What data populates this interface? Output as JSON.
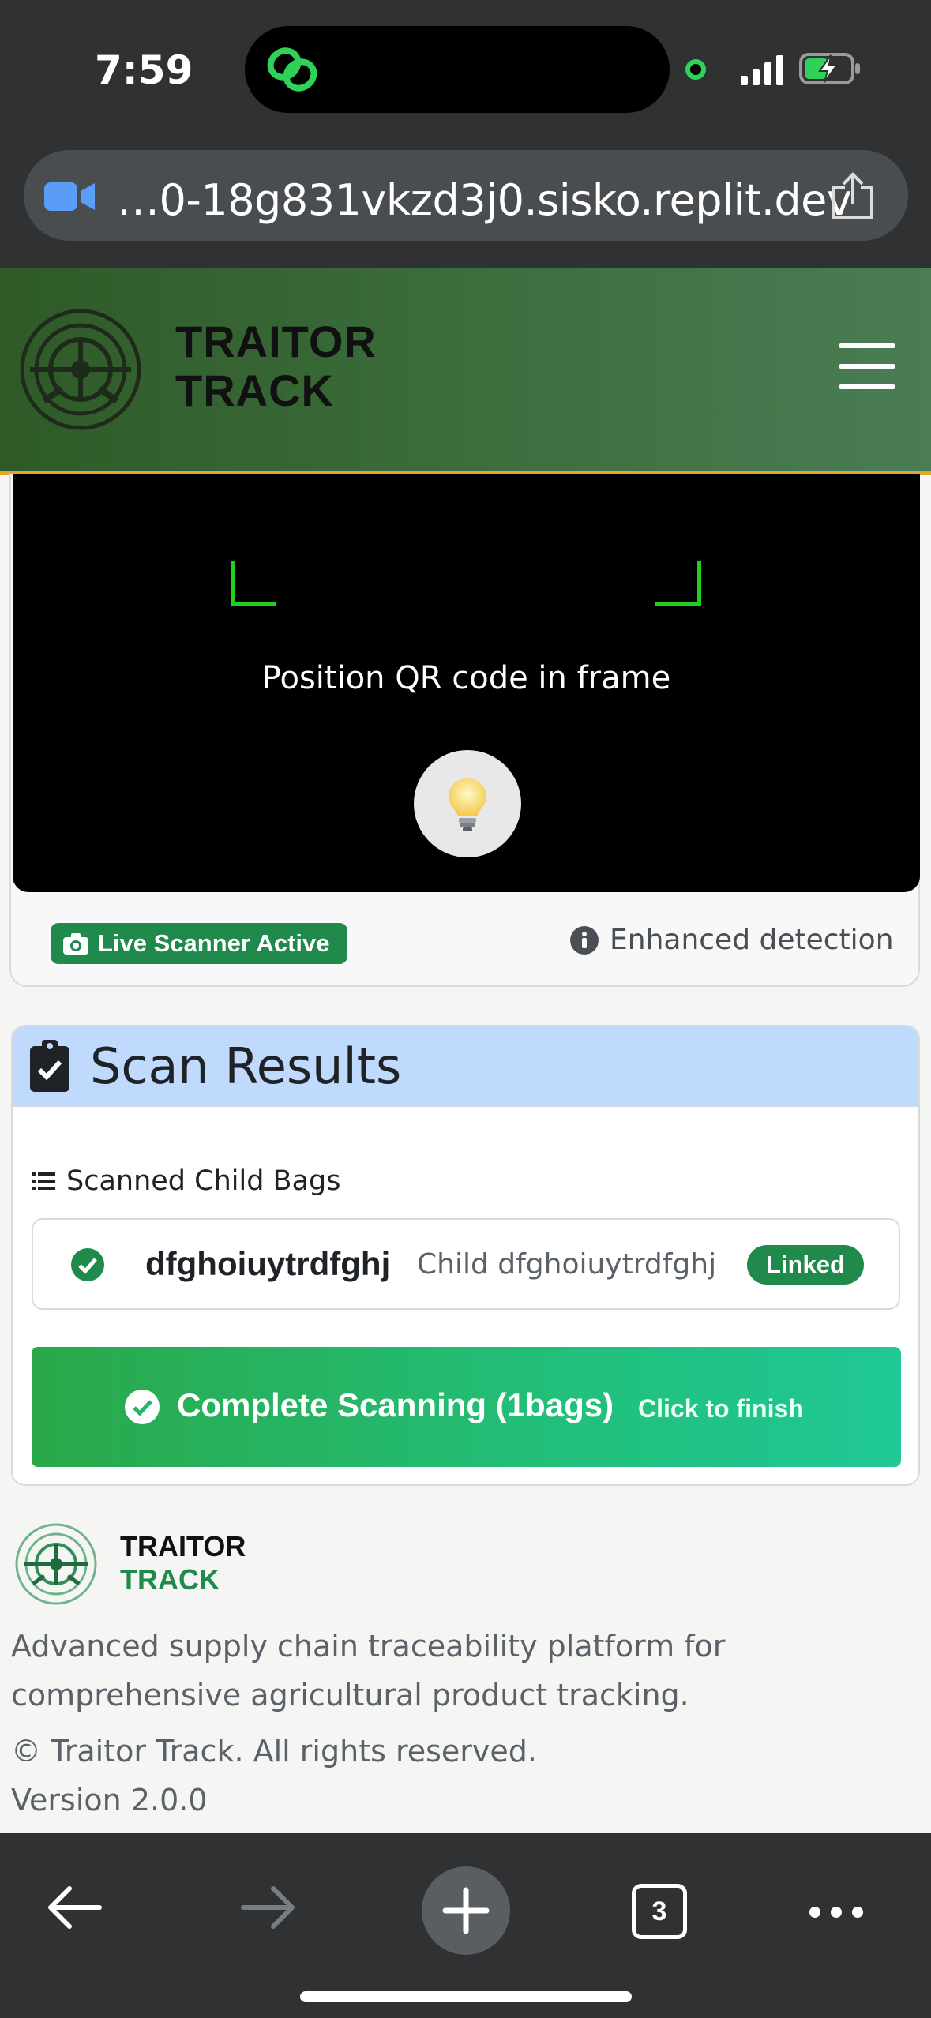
{
  "status_bar": {
    "time": "7:59"
  },
  "browser": {
    "url": "…0-18g831vkzd3j0.sisko.replit.dev",
    "tab_count": "3"
  },
  "header": {
    "brand_line1": "TRAITOR",
    "brand_line2": "TRACK"
  },
  "scanner": {
    "frame_hint": "Position QR code in frame",
    "live_badge": "Live Scanner Active",
    "detection_mode": "Enhanced detection"
  },
  "results": {
    "title": "Scan Results",
    "subheading": "Scanned Child Bags",
    "items": [
      {
        "id": "dfghoiuytrdfghj",
        "description": "Child dfghoiuytrdfghj",
        "status": "Linked"
      }
    ],
    "complete_label": "Complete Scanning (1bags)",
    "complete_sub": "Click to finish"
  },
  "footer": {
    "brand_line1": "TRAITOR",
    "brand_line2": "TRACK",
    "description": "Advanced supply chain traceability platform for comprehensive agricultural product tracking.",
    "copyright": "© Traitor Track. All rights reserved.",
    "version": "Version 2.0.0"
  },
  "colors": {
    "brand_green": "#1f8a4c",
    "header_border": "#e0a72b",
    "scan_corner": "#1fd11f",
    "results_header": "#bfdafc"
  }
}
